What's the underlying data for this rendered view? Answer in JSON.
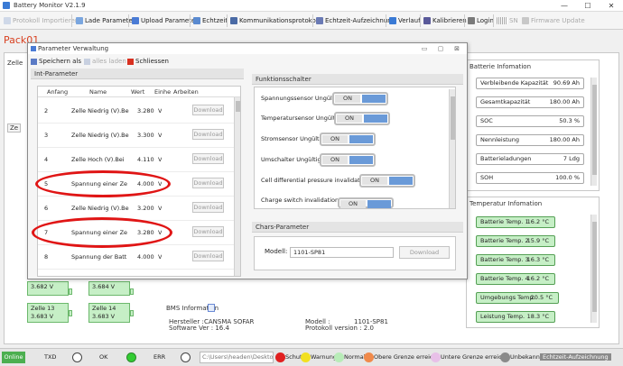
{
  "window": {
    "title": "Battery Monitor V2.1.9",
    "min": "—",
    "max": "☐",
    "close": "✕"
  },
  "toolbar": {
    "items": [
      {
        "label": "Protokoll Importieren",
        "icon": "import-icon",
        "enabled": false
      },
      {
        "label": "Lade Parameter",
        "icon": "load-params-icon",
        "enabled": true
      },
      {
        "label": "Upload Parameter",
        "icon": "upload-icon",
        "enabled": true
      },
      {
        "label": "Echtzeit",
        "icon": "realtime-icon",
        "enabled": true
      },
      {
        "label": "Kommunikationsprotokoll",
        "icon": "protocol-icon",
        "enabled": true
      },
      {
        "label": "Echtzeit-Aufzeichnung",
        "icon": "record-icon",
        "enabled": true
      },
      {
        "label": "Verlauf",
        "icon": "history-icon",
        "enabled": true
      },
      {
        "label": "Kalibrieren",
        "icon": "calibrate-icon",
        "enabled": true
      },
      {
        "label": "Login",
        "icon": "login-icon",
        "enabled": true
      },
      {
        "label": "SN",
        "icon": "barcode-icon",
        "enabled": false
      },
      {
        "label": "Firmware Update",
        "icon": "firmware-icon",
        "enabled": false
      }
    ]
  },
  "main": {
    "tab_label": "Pack01",
    "zelle_label": "Zelle",
    "z_label": "Ze",
    "cells_visible": [
      {
        "voltage": "3.682 V"
      },
      {
        "voltage": "3.684 V"
      },
      {
        "name": "Zelle 13",
        "voltage": "3.683 V"
      },
      {
        "name": "Zelle 14",
        "voltage": "3.683 V"
      }
    ],
    "bms_info": {
      "title": "BMS Information",
      "hersteller_label": "Hersteller :",
      "hersteller_value": "CANSMA  SOFAR",
      "software_label": "Software Ver : 16.4",
      "modell_label": "Modell :",
      "modell_value": "1101-SP81",
      "protokoll_label": "Protokoll version : 2.0"
    },
    "battery_info": {
      "title": "Batterie Infomation",
      "items": [
        {
          "label": "Verbleibende Kapazität",
          "value": "90.69 Ah"
        },
        {
          "label": "Gesamtkapazität",
          "value": "180.00 Ah"
        },
        {
          "label": "SOC",
          "value": "50.3 %"
        },
        {
          "label": "Nennleistung",
          "value": "180.00 Ah"
        },
        {
          "label": "Batterieladungen",
          "value": "7 Ldg"
        },
        {
          "label": "SOH",
          "value": "100.0 %"
        }
      ]
    },
    "temp_info": {
      "title": "Temperatur Infomation",
      "items": [
        {
          "label": "Batterie Temp. 1",
          "value": "16.2 °C"
        },
        {
          "label": "Batterie Temp. 2",
          "value": "15.9 °C"
        },
        {
          "label": "Batterie Temp. 3",
          "value": "16.3 °C"
        },
        {
          "label": "Batterie Temp. 4",
          "value": "16.2 °C"
        },
        {
          "label": "Umgebungs Temp.",
          "value": "20.5 °C"
        },
        {
          "label": "Leistung Temp.",
          "value": "18.3 °C"
        }
      ]
    }
  },
  "dialog": {
    "title": "Parameter Verwaltung",
    "tools": {
      "save": "Speichern als",
      "apply": "alles laden",
      "close": "Schliessen"
    },
    "int_params": {
      "title": "Int-Parameter",
      "headers": {
        "start": "Anfang",
        "name": "Name",
        "value": "Wert",
        "unit": "Einhe",
        "action": "Arbeiten"
      },
      "rows": [
        {
          "start": "2",
          "name": "Zelle Niedrig (V).Be",
          "value": "3.280",
          "unit": "V",
          "action": "Download"
        },
        {
          "start": "3",
          "name": "Zelle Niedrig (V).Be",
          "value": "3.300",
          "unit": "V",
          "action": "Download"
        },
        {
          "start": "4",
          "name": "Zelle Hoch (V).Bei",
          "value": "4.110",
          "unit": "V",
          "action": "Download"
        },
        {
          "start": "5",
          "name": "Spannung einer Ze",
          "value": "4.000",
          "unit": "V",
          "action": "Download"
        },
        {
          "start": "6",
          "name": "Zelle Niedrig (V).Be",
          "value": "3.200",
          "unit": "V",
          "action": "Download"
        },
        {
          "start": "7",
          "name": "Spannung einer Ze",
          "value": "3.280",
          "unit": "V",
          "action": "Download"
        },
        {
          "start": "8",
          "name": "Spannung der Batt",
          "value": "4.000",
          "unit": "V",
          "action": "Download"
        }
      ]
    },
    "func_switch": {
      "title": "Funktionsschalter",
      "items": [
        {
          "label": "Spannungssensor Ungültig",
          "state": "ON"
        },
        {
          "label": "Temperatursensor Ungültig",
          "state": "ON"
        },
        {
          "label": "Stromsensor Ungültig",
          "state": "ON"
        },
        {
          "label": "Umschalter Ungültig",
          "state": "ON"
        },
        {
          "label": "Cell differential pressure invalidation",
          "state": "ON"
        },
        {
          "label": "Charge switch invalidation",
          "state": "ON"
        }
      ]
    },
    "chars_params": {
      "title": "Chars-Parameter",
      "model_label": "Modell:",
      "model_value": "1101-SP81",
      "download": "Download"
    }
  },
  "statusbar": {
    "online": "Online",
    "txd": "TXD",
    "ok": "OK",
    "err": "ERR",
    "path": "C:\\Users\\headen\\Deskto",
    "legend": [
      {
        "label": "Schutz",
        "color": "#e02020"
      },
      {
        "label": "Warnung",
        "color": "#f2e020"
      },
      {
        "label": "Normal",
        "color": "#33cc33"
      },
      {
        "label": "Obere Grenze erreicht",
        "color": "#f08a4b"
      },
      {
        "label": "Untere Grenze erreicht",
        "color": "#e8c0e8"
      },
      {
        "label": "Unbekannt",
        "color": "#8a8a8a"
      }
    ],
    "right": "Echtzeit-Aufzeichnung"
  }
}
